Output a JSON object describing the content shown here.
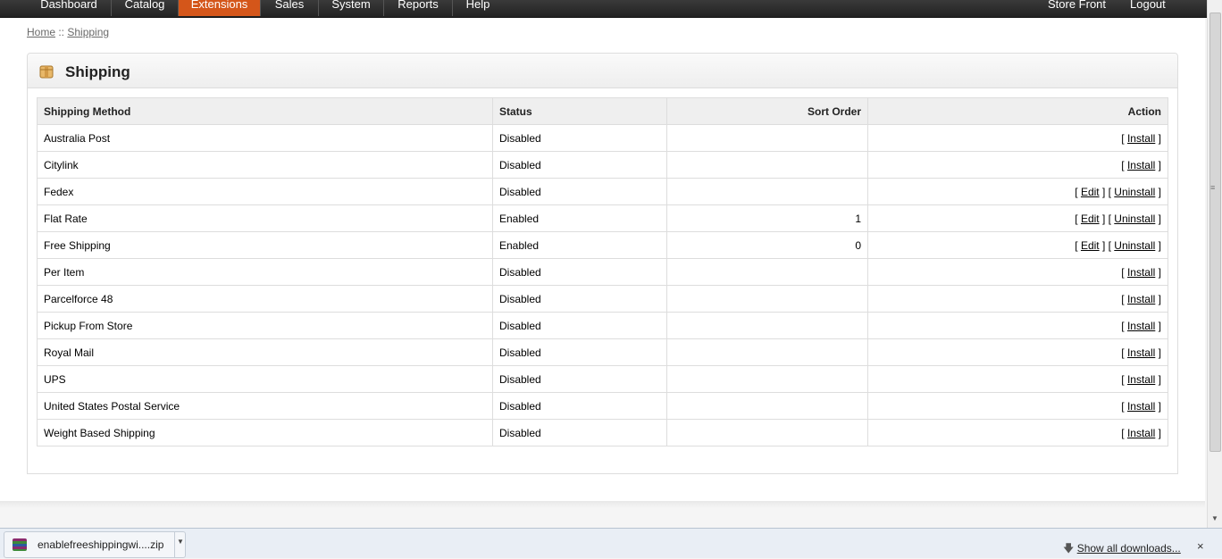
{
  "nav": {
    "items": [
      "Dashboard",
      "Catalog",
      "Extensions",
      "Sales",
      "System",
      "Reports",
      "Help"
    ],
    "active": "Extensions",
    "right": [
      "Store Front",
      "Logout"
    ]
  },
  "breadcrumb": {
    "home": "Home",
    "sep": " :: ",
    "current": "Shipping"
  },
  "box": {
    "title": "Shipping"
  },
  "table": {
    "headers": [
      "Shipping Method",
      "Status",
      "Sort Order",
      "Action"
    ],
    "rows": [
      {
        "method": "Australia Post",
        "status": "Disabled",
        "sort": "",
        "actions": [
          "Install"
        ]
      },
      {
        "method": "Citylink",
        "status": "Disabled",
        "sort": "",
        "actions": [
          "Install"
        ]
      },
      {
        "method": "Fedex",
        "status": "Disabled",
        "sort": "",
        "actions": [
          "Edit",
          "Uninstall"
        ]
      },
      {
        "method": "Flat Rate",
        "status": "Enabled",
        "sort": "1",
        "actions": [
          "Edit",
          "Uninstall"
        ]
      },
      {
        "method": "Free Shipping",
        "status": "Enabled",
        "sort": "0",
        "actions": [
          "Edit",
          "Uninstall"
        ]
      },
      {
        "method": "Per Item",
        "status": "Disabled",
        "sort": "",
        "actions": [
          "Install"
        ]
      },
      {
        "method": "Parcelforce 48",
        "status": "Disabled",
        "sort": "",
        "actions": [
          "Install"
        ]
      },
      {
        "method": "Pickup From Store",
        "status": "Disabled",
        "sort": "",
        "actions": [
          "Install"
        ]
      },
      {
        "method": "Royal Mail",
        "status": "Disabled",
        "sort": "",
        "actions": [
          "Install"
        ]
      },
      {
        "method": "UPS",
        "status": "Disabled",
        "sort": "",
        "actions": [
          "Install"
        ]
      },
      {
        "method": "United States Postal Service",
        "status": "Disabled",
        "sort": "",
        "actions": [
          "Install"
        ]
      },
      {
        "method": "Weight Based Shipping",
        "status": "Disabled",
        "sort": "",
        "actions": [
          "Install"
        ]
      }
    ]
  },
  "downloads": {
    "file": "enablefreeshippingwi....zip",
    "show_all": "Show all downloads...",
    "close": "×"
  },
  "icons": {
    "box": "package-icon",
    "download": "winrar-archive-icon",
    "arrow": "download-arrow-icon"
  }
}
